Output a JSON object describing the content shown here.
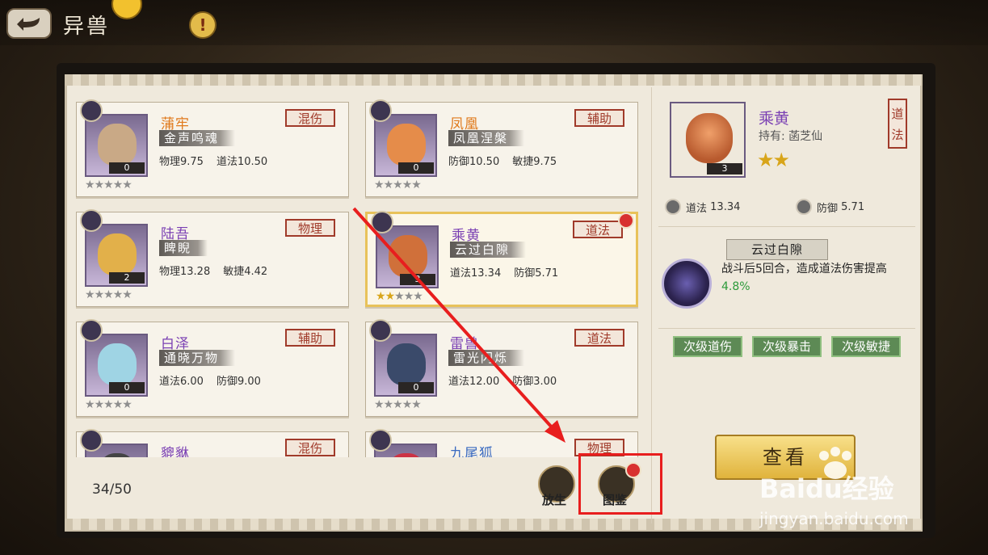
{
  "header": {
    "title": "异兽",
    "info_label": "!"
  },
  "beasts": [
    {
      "name": "蒲牢",
      "name_color": "#e07a1d",
      "skill": "金声鸣魂",
      "type": "混伤",
      "stats": [
        "物理9.75",
        "道法10.50"
      ],
      "count": "0",
      "stars": 0,
      "face": "#c9a986"
    },
    {
      "name": "凤凰",
      "name_color": "#e07a1d",
      "skill": "凤凰涅槃",
      "type": "辅助",
      "stats": [
        "防御10.50",
        "敏捷9.75"
      ],
      "count": "0",
      "stars": 0,
      "face": "#e58c4a"
    },
    {
      "name": "陆吾",
      "name_color": "#7a3fb3",
      "skill": "睥睨",
      "type": "物理",
      "stats": [
        "物理13.28",
        "敏捷4.42"
      ],
      "count": "2",
      "stars": 0,
      "face": "#e2b04a"
    },
    {
      "name": "乘黄",
      "name_color": "#7a3fb3",
      "skill": "云过白隙",
      "type": "道法",
      "stats": [
        "道法13.34",
        "防御5.71"
      ],
      "count": "3",
      "stars": 2,
      "face": "#d0703a"
    },
    {
      "name": "白泽",
      "name_color": "#7a3fb3",
      "skill": "通晓万物",
      "type": "辅助",
      "stats": [
        "道法6.00",
        "防御9.00"
      ],
      "count": "0",
      "stars": 0,
      "face": "#9fd4e4"
    },
    {
      "name": "雷兽",
      "name_color": "#7a3fb3",
      "skill": "雷光闪烁",
      "type": "道法",
      "stats": [
        "道法12.00",
        "防御3.00"
      ],
      "count": "0",
      "stars": 0,
      "face": "#3a4a6a"
    },
    {
      "name": "貔貅",
      "name_color": "#7a3fb3",
      "skill": "",
      "type": "混伤",
      "stats": [],
      "count": "",
      "stars": 0,
      "face": "#444"
    },
    {
      "name": "九尾狐",
      "name_color": "#3a6ac0",
      "skill": "",
      "type": "物理",
      "stats": [],
      "count": "",
      "stars": 0,
      "face": "#c34"
    }
  ],
  "footer": {
    "count": "34/50",
    "release_label": "放生",
    "catalog_label": "图鉴"
  },
  "detail": {
    "name": "乘黄",
    "owner": "持有: 菡芝仙",
    "count": "3",
    "stars": "★★",
    "type": "道法",
    "attrs": [
      {
        "label": "道法",
        "value": "13.34"
      },
      {
        "label": "防御",
        "value": "5.71"
      }
    ],
    "skill_title": "云过白隙",
    "skill_desc_pre": "战斗后5回合，造成道法伤害提高",
    "skill_desc_value": "4.8%",
    "tags": [
      "次级道伤",
      "次级暴击",
      "次级敏捷"
    ],
    "view_label": "查看"
  },
  "watermark": {
    "line1": "Baidu经验",
    "line2": "jingyan.baidu.com"
  }
}
